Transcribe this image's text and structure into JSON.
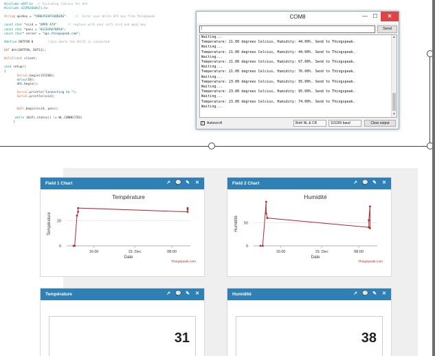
{
  "code_lines": [
    {
      "parts": [
        {
          "t": "#include <DHT.h>",
          "c": "c-kw"
        },
        {
          "t": "  // Including library for dht",
          "c": "c-cm"
        }
      ]
    },
    {
      "parts": [
        {
          "t": "#include <ESP8266WiFi.h>",
          "c": "c-kw"
        }
      ]
    },
    {
      "parts": []
    },
    {
      "parts": [
        {
          "t": "String",
          "c": "c-ty"
        },
        {
          "t": " apiKey = ",
          "c": "c-pl"
        },
        {
          "t": "\"YXB0J5GVFCUUDZ4G\"",
          "c": "c-str"
        },
        {
          "t": ";    //  Enter your Write API key from ThingSpeak",
          "c": "c-cm"
        }
      ]
    },
    {
      "parts": []
    },
    {
      "parts": [
        {
          "t": "const char",
          "c": "c-kw"
        },
        {
          "t": " *ssid = ",
          "c": "c-pl"
        },
        {
          "t": "\"OPPO A74\"",
          "c": "c-str"
        },
        {
          "t": ";     // replace with your wifi ssid and wpa2 key",
          "c": "c-cm"
        }
      ]
    },
    {
      "parts": [
        {
          "t": "const char",
          "c": "c-kw"
        },
        {
          "t": " *pass = ",
          "c": "c-pl"
        },
        {
          "t": "\"012345678910\"",
          "c": "c-str"
        },
        {
          "t": ";",
          "c": "c-pl"
        }
      ]
    },
    {
      "parts": [
        {
          "t": "const char",
          "c": "c-kw"
        },
        {
          "t": "* server = ",
          "c": "c-pl"
        },
        {
          "t": "\"api.thingspeak.com\"",
          "c": "c-str"
        },
        {
          "t": ";",
          "c": "c-pl"
        }
      ]
    },
    {
      "parts": []
    },
    {
      "parts": [
        {
          "t": "#define",
          "c": "c-kw"
        },
        {
          "t": " DHTPIN 0        ",
          "c": "c-pl"
        },
        {
          "t": "//pin where the dht11 is connected",
          "c": "c-cm"
        }
      ]
    },
    {
      "parts": []
    },
    {
      "parts": [
        {
          "t": "DHT",
          "c": "c-ty"
        },
        {
          "t": " dht(DHTPIN, DHT11);",
          "c": "c-pl"
        }
      ]
    },
    {
      "parts": []
    },
    {
      "parts": [
        {
          "t": "WiFiClient",
          "c": "c-ty"
        },
        {
          "t": " client;",
          "c": "c-pl"
        }
      ]
    },
    {
      "parts": []
    },
    {
      "parts": [
        {
          "t": "void",
          "c": "c-kw"
        },
        {
          "t": " setup()",
          "c": "c-pl"
        }
      ]
    },
    {
      "parts": [
        {
          "t": "{",
          "c": "c-pl"
        }
      ]
    },
    {
      "parts": [
        {
          "t": "       Serial",
          "c": "c-ty"
        },
        {
          "t": ".begin(115200);",
          "c": "c-pl"
        }
      ]
    },
    {
      "parts": [
        {
          "t": "       delay",
          "c": "c-kw"
        },
        {
          "t": "(10);",
          "c": "c-pl"
        }
      ]
    },
    {
      "parts": [
        {
          "t": "       dht.begin();",
          "c": "c-pl"
        }
      ]
    },
    {
      "parts": []
    },
    {
      "parts": [
        {
          "t": "       Serial",
          "c": "c-ty"
        },
        {
          "t": ".println(",
          "c": "c-pl"
        },
        {
          "t": "\"Connecting to \"",
          "c": "c-str"
        },
        {
          "t": ");",
          "c": "c-pl"
        }
      ]
    },
    {
      "parts": [
        {
          "t": "       Serial",
          "c": "c-ty"
        },
        {
          "t": ".println(ssid);",
          "c": "c-pl"
        }
      ]
    },
    {
      "parts": []
    },
    {
      "parts": []
    },
    {
      "parts": [
        {
          "t": "       WiFi",
          "c": "c-ty"
        },
        {
          "t": ".begin(ssid, pass);",
          "c": "c-pl"
        }
      ]
    },
    {
      "parts": []
    },
    {
      "parts": [
        {
          "t": "      while",
          "c": "c-kw"
        },
        {
          "t": " (WiFi.status() != WL_CONNECTED)",
          "c": "c-pl"
        }
      ]
    },
    {
      "parts": [
        {
          "t": "     {",
          "c": "c-pl"
        }
      ]
    }
  ],
  "serial_monitor": {
    "title": "COM8",
    "min_glyph": "—",
    "max_glyph": "☐",
    "close_glyph": "✕",
    "input_value": "|",
    "send_label": "Send",
    "lines": [
      "Waiting...",
      "Temperature: 21.00 degrees Celcius, Humidity: 44.00%. Send to Thingspeak.",
      "Waiting...",
      "Temperature: 21.00 degrees Celcius, Humidity: 44.00%. Send to Thingspeak.",
      "Waiting...",
      "Temperature: 21.00 degrees Celcius, Humidity: 67.00%. Send to Thingspeak.",
      "Waiting...",
      "Temperature: 21.00 degrees Celcius, Humidity: 76.00%. Send to Thingspeak.",
      "Waiting...",
      "Temperature: 23.00 degrees Celcius, Humidity: 95.00%. Send to Thingspeak.",
      "Waiting...",
      "Temperature: 23.00 degrees Celcius, Humidity: 95.00%. Send to Thingspeak.",
      "Waiting...",
      "Temperature: 23.00 degrees Celcius, Humidity: 74.00%. Send to Thingspeak.",
      "Waiting..."
    ],
    "autoscroll_label": "Autoscroll",
    "autoscroll_check": "✓",
    "line_ending": "Both NL & CR",
    "baud": "115200 baud",
    "clear_label": "Clear output"
  },
  "panels": {
    "field1": {
      "title": "Field 1 Chart",
      "chart_title": "Température",
      "ylabel": "Température",
      "xlabel": "Date",
      "credit": "ThingSpeak.com",
      "x_ticks": [
        "16:00",
        "15. Dec",
        "08:00"
      ],
      "y_ticks": [
        "0",
        "20"
      ]
    },
    "field2": {
      "title": "Field 2 Chart",
      "chart_title": "Humidité",
      "ylabel": "Humidité",
      "xlabel": "Date",
      "credit": "ThingSpeak.com",
      "x_ticks": [
        "16:00",
        "15. Dec",
        "08:00"
      ],
      "y_ticks": [
        "0",
        "50"
      ]
    },
    "temp": {
      "title": "Température",
      "value": "31"
    },
    "hum": {
      "title": "Humidité",
      "value": "38"
    }
  },
  "panel_icons": [
    "↗",
    "💬",
    "✎",
    "✕"
  ],
  "chart_data": [
    {
      "type": "line",
      "title": "Température",
      "xlabel": "Date",
      "ylabel": "Température",
      "ylim": [
        0,
        35
      ],
      "x_ticks": [
        "16:00",
        "15. Dec",
        "08:00"
      ],
      "series": [
        {
          "values": [
            {
              "x": 0.0,
              "y": 0
            },
            {
              "x": 0.01,
              "y": 0
            },
            {
              "x": 0.03,
              "y": 24
            },
            {
              "x": 0.04,
              "y": 27
            },
            {
              "x": 0.04,
              "y": 30
            },
            {
              "x": 1.0,
              "y": 27
            },
            {
              "x": 1.0,
              "y": 30
            },
            {
              "x": 1.0,
              "y": 29
            }
          ]
        }
      ],
      "color": "#b5262e"
    },
    {
      "type": "line",
      "title": "Humidité",
      "xlabel": "Date",
      "ylabel": "Humidité",
      "ylim": [
        0,
        95
      ],
      "x_ticks": [
        "16:00",
        "15. Dec",
        "08:00"
      ],
      "series": [
        {
          "values": [
            {
              "x": 0.0,
              "y": 0
            },
            {
              "x": 0.02,
              "y": 0
            },
            {
              "x": 0.05,
              "y": 95
            },
            {
              "x": 0.05,
              "y": 70
            },
            {
              "x": 0.06,
              "y": 60
            },
            {
              "x": 0.95,
              "y": 40
            },
            {
              "x": 0.95,
              "y": 55
            },
            {
              "x": 0.96,
              "y": 85
            },
            {
              "x": 0.96,
              "y": 38
            }
          ]
        }
      ],
      "color": "#b5262e"
    }
  ],
  "colors": {
    "header_blue": "#2f80b5",
    "line_red": "#b5262e",
    "close_red": "#e04343"
  }
}
